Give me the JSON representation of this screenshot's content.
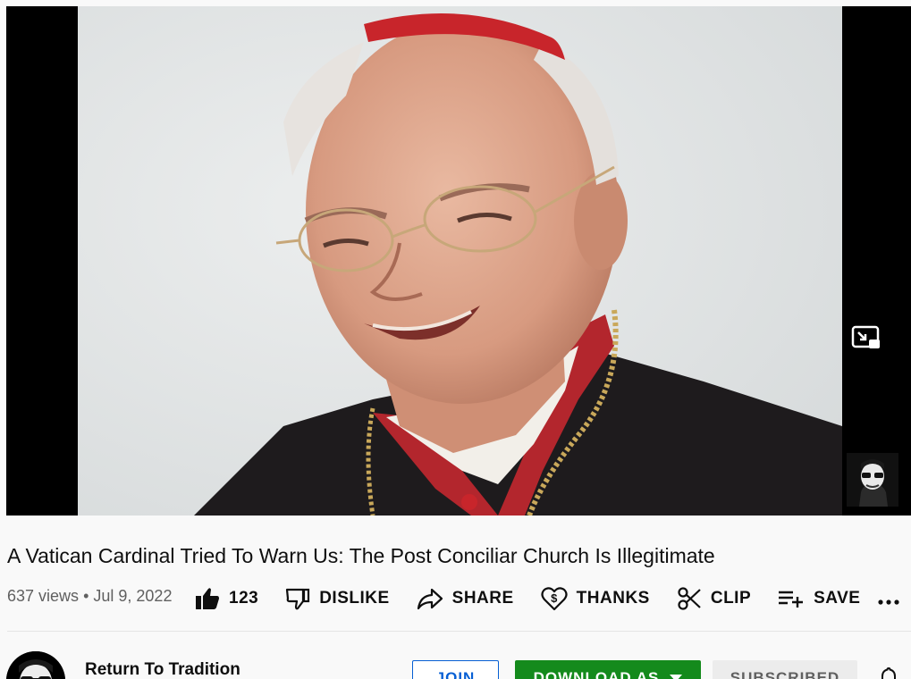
{
  "video": {
    "title": "A Vatican Cardinal Tried To Warn Us: The Post Conciliar Church Is Illegitimate",
    "views": "637 views",
    "separator": "•",
    "date": "Jul 9, 2022"
  },
  "actions": {
    "like_count": "123",
    "dislike_label": "DISLIKE",
    "share_label": "SHARE",
    "thanks_label": "THANKS",
    "clip_label": "CLIP",
    "save_label": "SAVE"
  },
  "channel": {
    "name": "Return To Tradition",
    "join_label": "JOIN",
    "download_label": "DOWNLOAD AS",
    "subscribed_label": "SUBSCRIBED"
  },
  "icons": {
    "like": "thumbs-up-icon",
    "dislike": "thumbs-down-icon",
    "share": "share-arrow-icon",
    "thanks": "heart-dollar-icon",
    "clip": "scissors-icon",
    "save": "playlist-add-icon",
    "more": "more-horizontal-icon",
    "pip": "picture-in-picture-icon",
    "bell": "bell-icon"
  },
  "colors": {
    "download_button": "#148a1c",
    "join_border": "#065fd4",
    "subscribed_bg": "#ececec"
  }
}
